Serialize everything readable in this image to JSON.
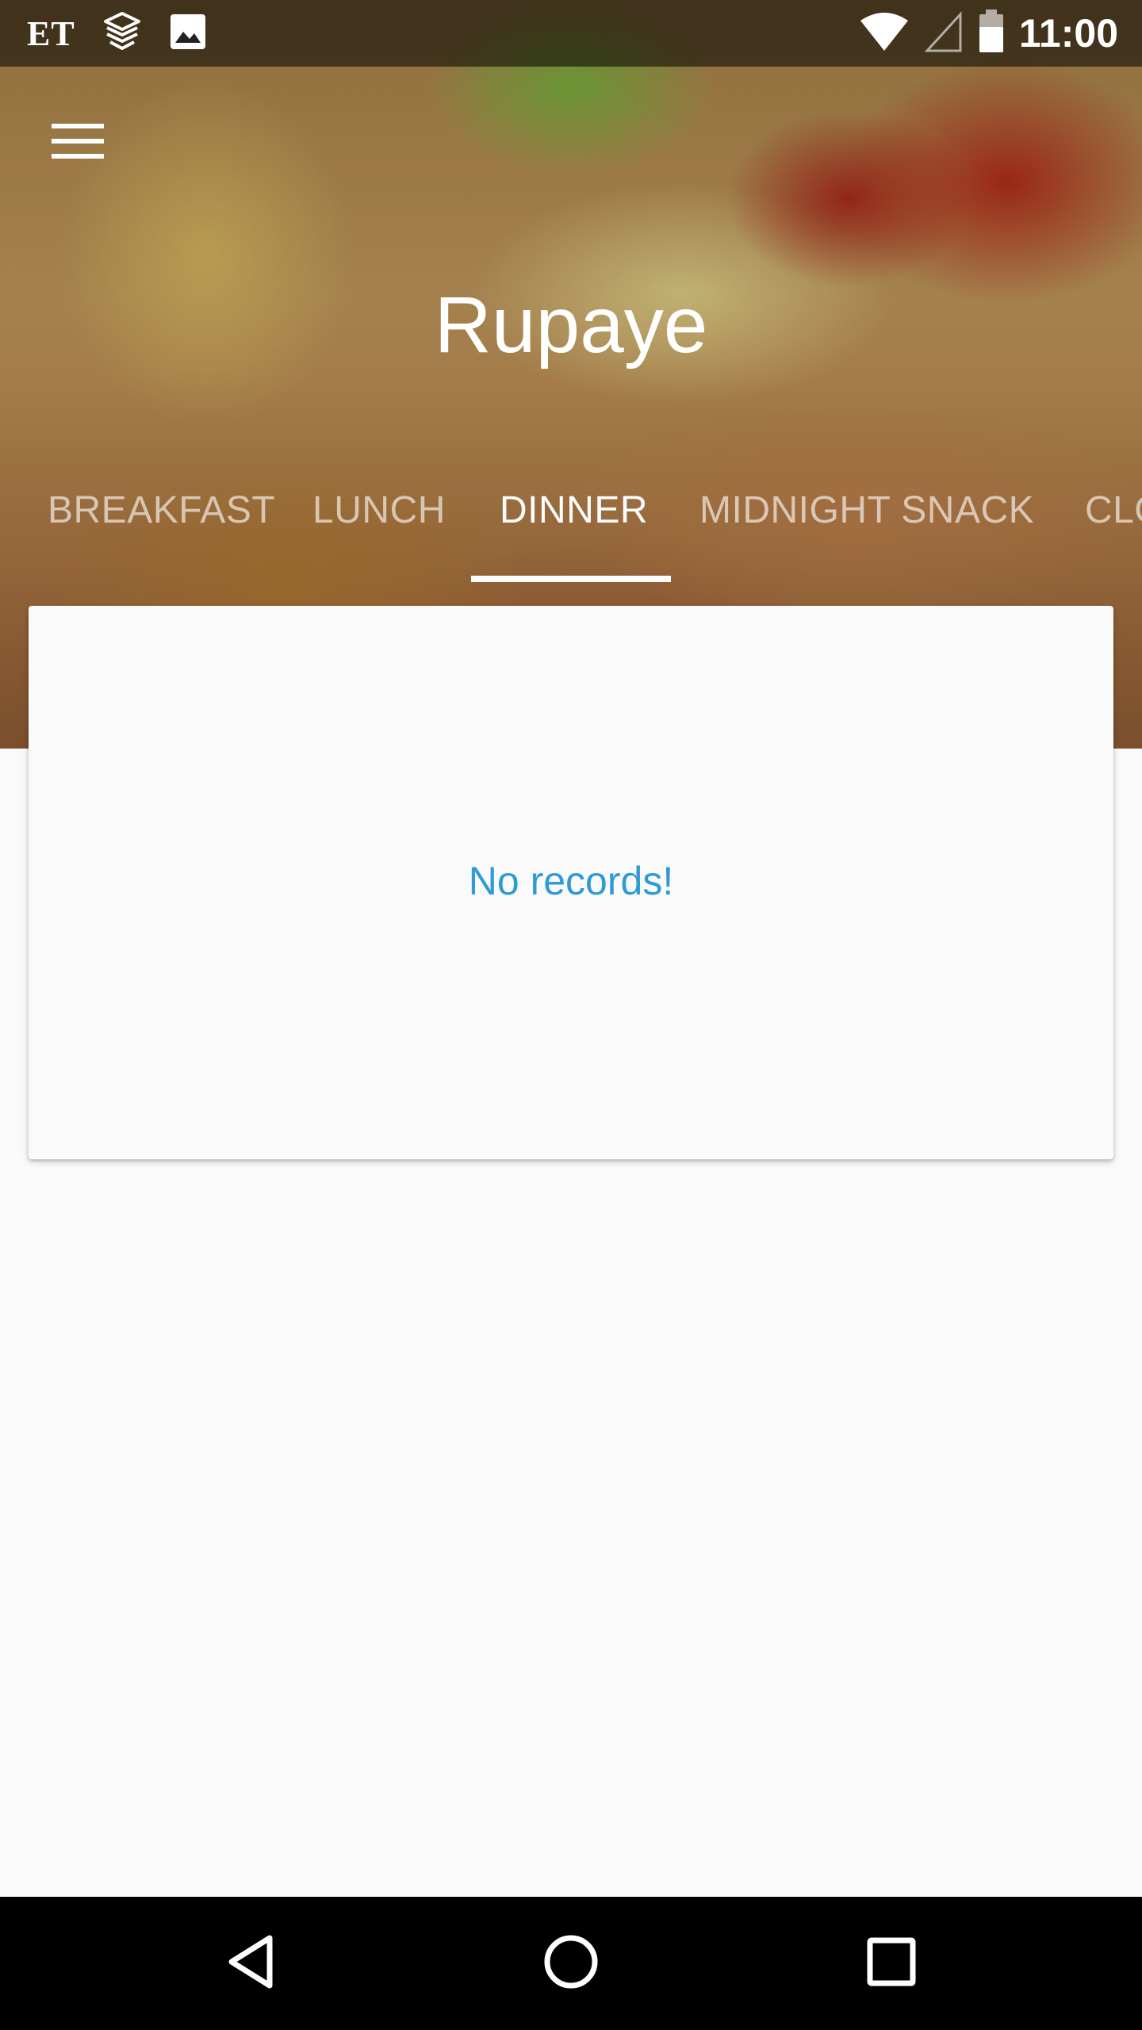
{
  "status_bar": {
    "carrier_label": "ET",
    "left_icons": [
      "et-logo-icon",
      "stack-notification-icon",
      "image-icon"
    ],
    "right_icons": [
      "wifi-icon",
      "cell-signal-icon",
      "battery-icon"
    ],
    "time": "11:00"
  },
  "toolbar": {
    "menu_icon": "hamburger-menu-icon",
    "title": "Rupaye"
  },
  "tabs": {
    "items": [
      {
        "label": "BREAKFAST",
        "active": false
      },
      {
        "label": "LUNCH",
        "active": false
      },
      {
        "label": "DINNER",
        "active": true
      },
      {
        "label": "MIDNIGHT SNACK",
        "active": false
      },
      {
        "label": "CLO",
        "active": false
      }
    ],
    "active_index": 2
  },
  "content": {
    "empty_message": "No records!"
  },
  "nav_bar": {
    "back_icon": "back-triangle-icon",
    "home_icon": "home-circle-icon",
    "recents_icon": "recents-square-icon"
  },
  "colors": {
    "accent": "#2e9ad6",
    "background": "#fafafa",
    "nav_bar": "#000000"
  }
}
